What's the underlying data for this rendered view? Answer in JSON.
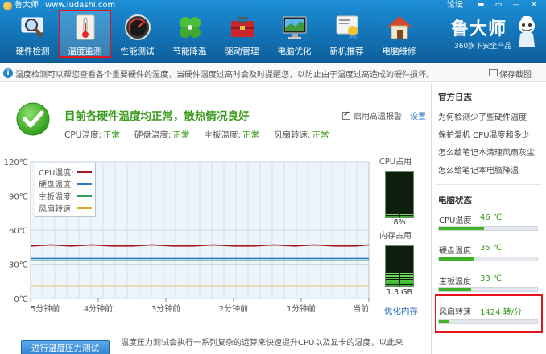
{
  "titlebar": {
    "app_name": "鲁大师",
    "url": "www.ludashi.com",
    "forum": "论坛",
    "controls": [
      "▬",
      "▭",
      "—",
      "✕"
    ]
  },
  "nav": {
    "items": [
      {
        "label": "硬件检测",
        "icon": "magnifier-icon"
      },
      {
        "label": "温度监测",
        "icon": "thermometer-icon",
        "active": true
      },
      {
        "label": "性能测试",
        "icon": "speedometer-icon"
      },
      {
        "label": "节能降温",
        "icon": "clover-icon"
      },
      {
        "label": "驱动管理",
        "icon": "toolbox-icon"
      },
      {
        "label": "电脑优化",
        "icon": "monitor-icon"
      },
      {
        "label": "新机推荐",
        "icon": "award-icon"
      },
      {
        "label": "电脑维修",
        "icon": "house-icon"
      }
    ]
  },
  "brand": {
    "name": "鲁大师",
    "subtitle": "360旗下安全产品"
  },
  "infobar": {
    "text": "温度检测可以帮您查看各个重要硬件的温度，当硬件温度过高时会及时提醒您，以防止由于温度过高造成的硬件损坏。",
    "save": "保存截图"
  },
  "status": {
    "title": "目前各硬件温度均正常，散热情况良好",
    "items": [
      {
        "key": "CPU温度:",
        "value": "正常"
      },
      {
        "key": "硬盘温度:",
        "value": "正常"
      },
      {
        "key": "主板温度:",
        "value": "正常"
      },
      {
        "key": "风扇转速:",
        "value": "正常"
      }
    ],
    "alarm_label": "启用高温报警",
    "alarm_checked": true,
    "settings": "设置"
  },
  "chart_data": {
    "type": "line",
    "y_ticks": [
      "120℃",
      "90℃",
      "60℃",
      "30℃",
      "0℃"
    ],
    "ylim": [
      0,
      120
    ],
    "x_ticks": [
      "5分钟前",
      "4分钟前",
      "3分钟前",
      "2分钟前",
      "1分钟前",
      "当前"
    ],
    "xlim": [
      -5,
      0
    ],
    "grid": true,
    "legend": "top-left",
    "series": [
      {
        "name": "CPU温度:",
        "color": "#9e1c1c",
        "x": [
          -5,
          -4.7,
          -4.4,
          -4.1,
          -3.8,
          -3.5,
          -3.2,
          -2.9,
          -2.6,
          -2.3,
          -2.0,
          -1.7,
          -1.4,
          -1.1,
          -0.8,
          -0.5,
          -0.2,
          0
        ],
        "values": [
          46,
          47,
          46,
          47,
          46,
          46,
          47,
          46,
          46,
          47,
          46,
          46,
          47,
          46,
          47,
          46,
          46,
          47
        ]
      },
      {
        "name": "硬盘温度:",
        "color": "#2f78c4",
        "x": [
          -5,
          0
        ],
        "values": [
          35,
          35
        ]
      },
      {
        "name": "主板温度:",
        "color": "#2aa05a",
        "x": [
          -5,
          0
        ],
        "values": [
          33,
          33
        ]
      },
      {
        "name": "风扇转速:",
        "color": "#d6a81f",
        "x": [
          -5,
          0
        ],
        "values": [
          11,
          11
        ]
      }
    ]
  },
  "usage": {
    "cpu_title": "CPU占用",
    "cpu_value": "8%",
    "cpu_fraction": 0.08,
    "mem_title": "内存占用",
    "mem_value": "1.3 GB",
    "mem_fraction": 0.35,
    "optimize": "优化内存"
  },
  "stress": {
    "button": "进行温度压力测试",
    "desc": "温度压力测试会执行一系列复杂的运算来快速提升CPU以及显卡的温度，以此来"
  },
  "sidebar": {
    "tips_title": "官方日志",
    "tips": [
      "为何检测少了些硬件温度",
      "保护爱机 CPU温度和多少",
      "怎么给笔记本清理风扇灰尘",
      "怎么给笔记本电脑降温"
    ],
    "status_title": "电脑状态",
    "stats": [
      {
        "label": "CPU温度",
        "value": "46 ℃",
        "fraction": 0.46
      },
      {
        "label": "硬盘温度",
        "value": "35 ℃",
        "fraction": 0.35
      },
      {
        "label": "主板温度",
        "value": "33 ℃",
        "fraction": 0.33
      },
      {
        "label": "风扇转速",
        "value": "1424 转/分",
        "fraction": 0.1
      }
    ]
  }
}
